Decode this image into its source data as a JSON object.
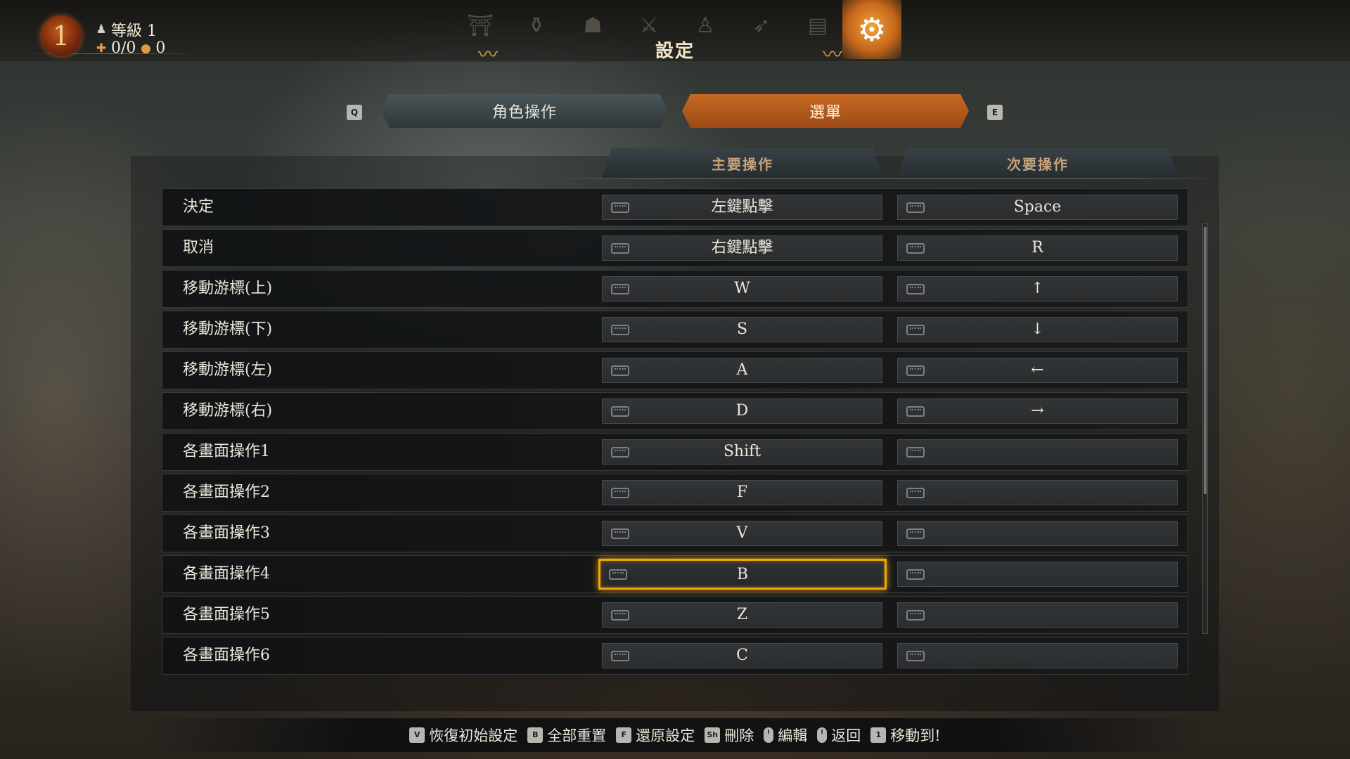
{
  "player": {
    "level_number": "1",
    "level_label": "等級 1",
    "resource_a": "0/0",
    "resource_b": "0"
  },
  "header": {
    "title": "設定",
    "menu_icons": [
      "rest-icon",
      "item-icon",
      "character-icon",
      "weapons-icon",
      "meditation-icon",
      "skill-icon",
      "map-icon",
      "settings-icon"
    ],
    "active_icon": "settings-icon"
  },
  "tabs": {
    "left_key": "Q",
    "right_key": "E",
    "items": [
      {
        "label": "角色操作",
        "active": false
      },
      {
        "label": "選單",
        "active": true
      }
    ]
  },
  "columns": {
    "primary": "主要操作",
    "secondary": "次要操作"
  },
  "bindings": [
    {
      "action": "決定",
      "primary": "左鍵點擊",
      "secondary": "Space"
    },
    {
      "action": "取消",
      "primary": "右鍵點擊",
      "secondary": "R"
    },
    {
      "action": "移動游標(上)",
      "primary": "W",
      "secondary": "↑"
    },
    {
      "action": "移動游標(下)",
      "primary": "S",
      "secondary": "↓"
    },
    {
      "action": "移動游標(左)",
      "primary": "A",
      "secondary": "←"
    },
    {
      "action": "移動游標(右)",
      "primary": "D",
      "secondary": "→"
    },
    {
      "action": "各畫面操作1",
      "primary": "Shift",
      "secondary": ""
    },
    {
      "action": "各畫面操作2",
      "primary": "F",
      "secondary": ""
    },
    {
      "action": "各畫面操作3",
      "primary": "V",
      "secondary": ""
    },
    {
      "action": "各畫面操作4",
      "primary": "B",
      "secondary": "",
      "selected": "primary"
    },
    {
      "action": "各畫面操作5",
      "primary": "Z",
      "secondary": ""
    },
    {
      "action": "各畫面操作6",
      "primary": "C",
      "secondary": ""
    }
  ],
  "bottom_hints": [
    {
      "key": "V",
      "label": "恢復初始設定"
    },
    {
      "key": "B",
      "label": "全部重置"
    },
    {
      "key": "F",
      "label": "還原設定"
    },
    {
      "key": "Sh",
      "label": "刪除"
    },
    {
      "key": "mouse-left-icon",
      "label": "編輯"
    },
    {
      "key": "mouse-right-icon",
      "label": "返回"
    },
    {
      "key": "1",
      "label": "移動到!"
    }
  ],
  "colors": {
    "accent": "#f2a800",
    "active_tab": "#c86a22",
    "column_header_text": "#c8a27a"
  }
}
